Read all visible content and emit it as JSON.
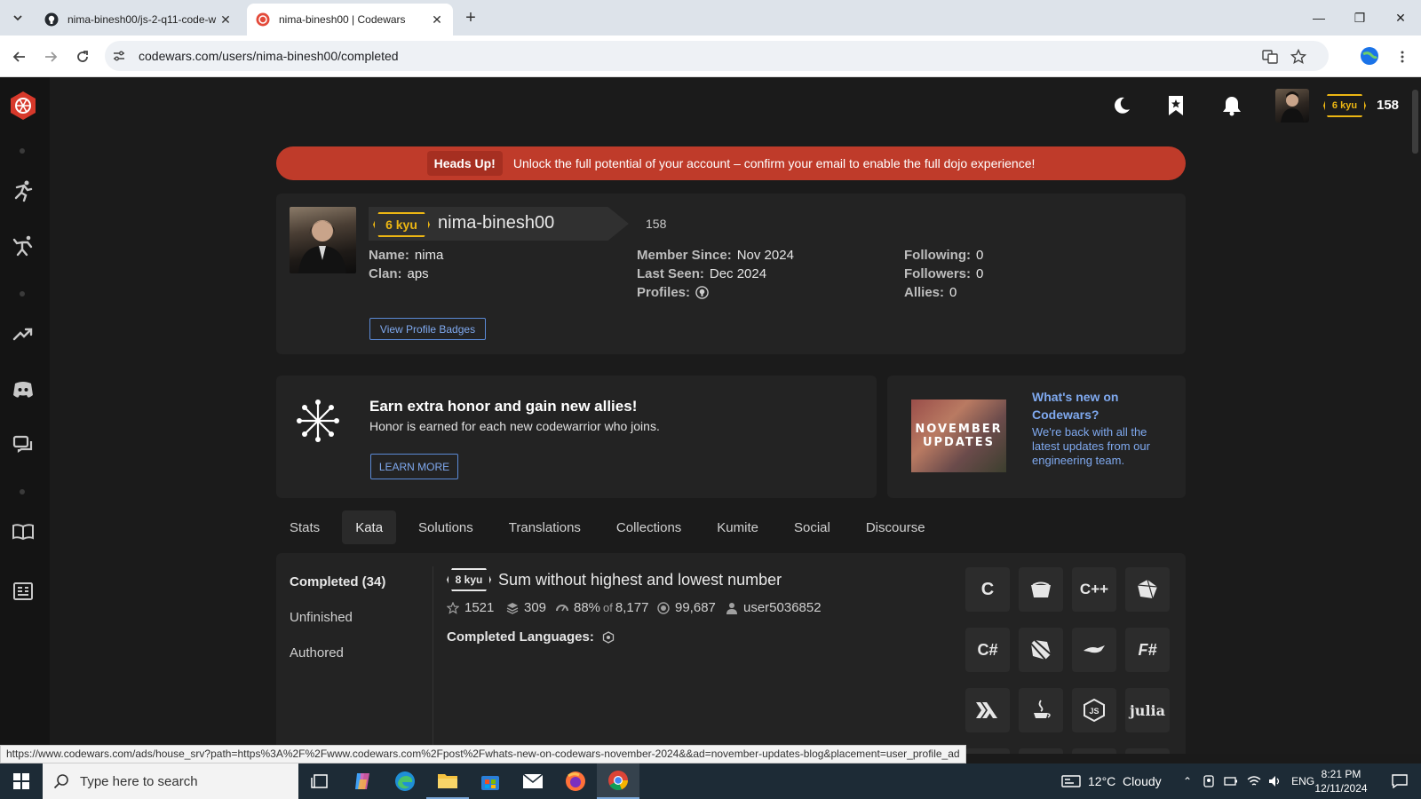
{
  "browser": {
    "tabs": [
      {
        "label": "nima-binesh00/js-2-q11-code-w"
      },
      {
        "label": "nima-binesh00 | Codewars"
      }
    ],
    "url": "codewars.com/users/nima-binesh00/completed",
    "status_url": "https://www.codewars.com/ads/house_srv?path=https%3A%2F%2Fwww.codewars.com%2Fpost%2Fwhats-new-on-codewars-november-2024&&ad=november-updates-blog&placement=user_profile_ad"
  },
  "topbar": {
    "kyu": "6 kyu",
    "honor": "158"
  },
  "alert": {
    "tag": "Heads Up!",
    "message": "Unlock the full potential of your account – confirm your email to enable the full dojo experience!"
  },
  "profile": {
    "kyu": "6 kyu",
    "username": "nima-binesh00",
    "honor": "158",
    "name_label": "Name:",
    "name": "nima",
    "clan_label": "Clan:",
    "clan": "aps",
    "member_label": "Member Since:",
    "member_since": "Nov 2024",
    "seen_label": "Last Seen:",
    "last_seen": "Dec 2024",
    "profiles_label": "Profiles:",
    "following_label": "Following:",
    "following": "0",
    "followers_label": "Followers:",
    "followers": "0",
    "allies_label": "Allies:",
    "allies": "0",
    "badges_button": "View Profile Badges"
  },
  "honor_card": {
    "title": "Earn extra honor and gain new allies!",
    "text": "Honor is earned for each new codewarrior who joins.",
    "button": "LEARN MORE"
  },
  "news_card": {
    "thumb_line1": "NOVEMBER",
    "thumb_line2": "UPDATES",
    "title": "What's new on Codewars?",
    "text": "We're back with all the latest updates from our engineering team."
  },
  "tabs": [
    "Stats",
    "Kata",
    "Solutions",
    "Translations",
    "Collections",
    "Kumite",
    "Social",
    "Discourse"
  ],
  "active_tab": "Kata",
  "subnav": [
    "Completed (34)",
    "Unfinished",
    "Authored"
  ],
  "kata": {
    "kyu": "8 kyu",
    "title": "Sum without highest and lowest number",
    "stars": "1521",
    "collections": "309",
    "satisfaction": "88%",
    "of": "of",
    "votes": "8,177",
    "completed": "99,687",
    "author": "user5036852",
    "completed_languages_label": "Completed Languages:"
  },
  "languages": [
    "C",
    "CoffeeScript",
    "C++",
    "Crystal",
    "C#",
    "Dart",
    "Elixir",
    "F#",
    "Haskell",
    "Java",
    "JavaScript",
    "Julia"
  ],
  "language_glyphs": [
    "C",
    "",
    "C++",
    "",
    "C#",
    "",
    "",
    "F#",
    "",
    "",
    "",
    "julia"
  ],
  "taskbar": {
    "search_placeholder": "Type here to search",
    "weather": "12°C  Cloudy",
    "lang": "ENG",
    "time": "8:21 PM",
    "date": "12/11/2024"
  },
  "colors": {
    "accent": "#bf3b2a",
    "kyu_yellow": "#ecb613",
    "link_blue": "#7fa9ef",
    "background": "#1b1b1b"
  }
}
